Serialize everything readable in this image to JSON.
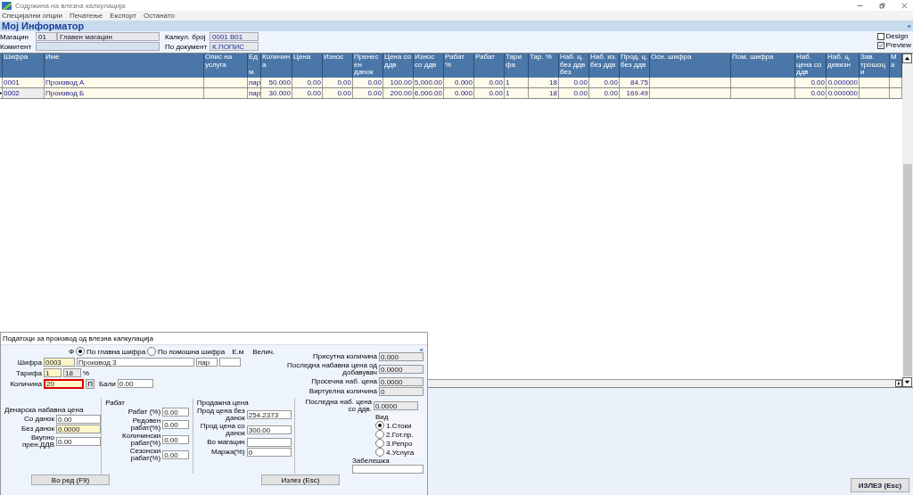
{
  "window": {
    "title": "Содржина на влезна калкулација"
  },
  "menu": [
    "Специјални опции",
    "Печатење",
    "Експорт",
    "Останато"
  ],
  "header": {
    "title": "Мој Информатор",
    "collapse": "«"
  },
  "info": [
    {
      "label": "Магацин",
      "code": "01",
      "value": "Главен магацин"
    },
    {
      "label": "Комитент"
    }
  ],
  "info_right": [
    {
      "label": "Калкул. број",
      "value": "0001   В01"
    },
    {
      "label": "По документ",
      "value": "К.ПОПИС"
    }
  ],
  "options": [
    {
      "label": "Design",
      "checked": false
    },
    {
      "label": "Preview",
      "checked": true
    }
  ],
  "table": {
    "columns": [
      "Шифра",
      "Име",
      "Опис на услуга",
      "Ед. м.",
      "Количина",
      "Цена",
      "Износ",
      "Пренесен данок",
      "Цена со ддв",
      "Износ со ддв",
      "Рабат %",
      "Рабат",
      "Тарифа",
      "Тар. %",
      "Наб. ц. без ддв без",
      "Наб. из. без ддв",
      "Прод. ц. без ддв",
      "Осн. шифра",
      "Пом. шифра",
      "Наб. цена со ддв",
      "Наб. ц. девизн",
      "Зав. трошоци",
      "Ма"
    ],
    "rows": [
      {
        "selected": false,
        "cells": [
          "0001",
          "Производ А",
          null,
          "пар",
          "50.000",
          "0.00",
          "0.00",
          "0.00",
          "100.00",
          "5,000.00",
          "0.000",
          "0.00",
          "1",
          "18",
          "0.00",
          "0.00",
          "84.75",
          null,
          null,
          "0.00",
          "0.000000",
          null,
          null
        ]
      },
      {
        "selected": true,
        "cells": [
          "0002",
          "Производ Б",
          null,
          "пар",
          "30.000",
          "0.00",
          "0.00",
          "0.00",
          "200.00",
          "6,000.00",
          "0.000",
          "0.00",
          "1",
          "18",
          "0.00",
          "0.00",
          "169.49",
          null,
          null,
          "0.00",
          "0.000000",
          null,
          null
        ]
      }
    ]
  },
  "exit_button": "ИЗЛЕЗ (Esc)",
  "dialog": {
    "title": "Податоци за производ од влезна калкулација",
    "collapse": "«",
    "search_label": "Ф",
    "search_by": [
      {
        "label": "По главна шифра",
        "selected": true
      },
      {
        "label": "По помошна шифра",
        "selected": false
      }
    ],
    "unit_label": "Е.м",
    "size_label": "Велич.",
    "code": {
      "label": "Шифра",
      "value": "0003"
    },
    "name": "Производ 3",
    "unit": "пар",
    "tariff": {
      "label": "Тарифа",
      "value": "1",
      "rate": "18",
      "suffix": "%"
    },
    "quantity": {
      "label": "Количина",
      "value": "20"
    },
    "p_button": "П",
    "points": {
      "label": "Бали",
      "value": "0.00"
    },
    "stock": [
      {
        "label": "Присутна количина",
        "value": "0.000"
      },
      {
        "label": "Последна набавна цена од добавувач",
        "value": "0.0000"
      },
      {
        "label": "Просечна наб. цена",
        "value": "0.0000"
      },
      {
        "label": "Виртуелна количина",
        "value": "0"
      }
    ],
    "purchase": {
      "title": "Денарска набавна цена",
      "fields": [
        {
          "label": "Со данок",
          "value": "0.00",
          "highlight": false
        },
        {
          "label": "Без данок",
          "value": "0.0000",
          "highlight": true
        },
        {
          "label": "Вкупно прен.ДДВ",
          "value": "0.00",
          "highlight": false
        }
      ]
    },
    "discount": {
      "title": "Рабат",
      "fields": [
        {
          "label": "Рабат (%)",
          "value": "0.00"
        },
        {
          "label": "Редовен рабат(%)",
          "value": "0.00"
        },
        {
          "label": "Количински рабат(%)",
          "value": "0.00"
        },
        {
          "label": "Сезонски рабат(%)",
          "value": "0.00"
        }
      ]
    },
    "sale": {
      "title": "Продажна цена",
      "fields": [
        {
          "label": "Прод цена без данок",
          "value": "254.2373"
        },
        {
          "label": "Прод цена со данок",
          "value": "300.00"
        },
        {
          "label": "Во магацин"
        },
        {
          "label": "Маржа(%)",
          "value": "0"
        }
      ]
    },
    "last_price": {
      "label": "Последна наб. цена со ддв.",
      "value": "0.0000"
    },
    "kind": {
      "label": "Вид",
      "options": [
        {
          "label": "1.Стоки",
          "selected": true
        },
        {
          "label": "2.Гот.пр.",
          "selected": false
        },
        {
          "label": "3.Репро",
          "selected": false
        },
        {
          "label": "4.Услуга",
          "selected": false
        }
      ]
    },
    "note": {
      "label": "Забелешка"
    },
    "buttons": [
      "Во ред (F9)",
      "Излез (Esc)"
    ]
  }
}
